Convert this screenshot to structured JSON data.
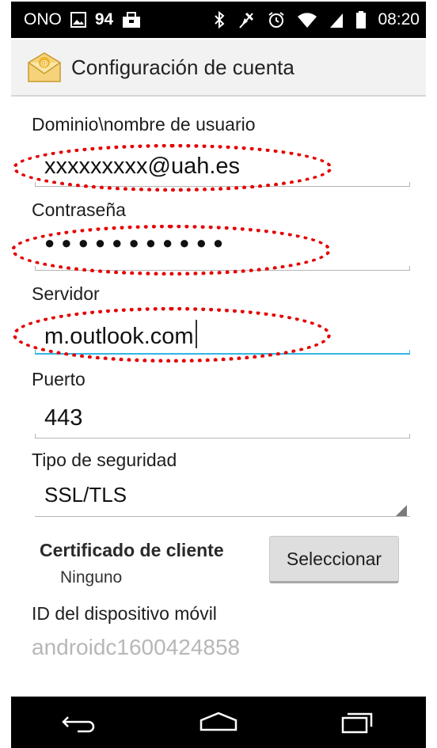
{
  "status_bar": {
    "carrier": "ONO",
    "notification_count": "94",
    "time": "08:20",
    "icons": [
      "gallery-icon",
      "briefcase-icon",
      "bluetooth-icon",
      "mute-icon",
      "alarm-icon",
      "wifi-icon",
      "signal-icon",
      "battery-icon"
    ]
  },
  "action_bar": {
    "icon": "email-app-icon",
    "title": "Configuración de cuenta"
  },
  "form": {
    "username": {
      "label": "Dominio\\nombre de usuario",
      "value": "xxxxxxxxx@uah.es"
    },
    "password": {
      "label": "Contraseña",
      "value": "●●●●●●●●●●●"
    },
    "server": {
      "label": "Servidor",
      "value": "m.outlook.com"
    },
    "port": {
      "label": "Puerto",
      "value": "443"
    },
    "security": {
      "label": "Tipo de seguridad",
      "value": "SSL/TLS"
    },
    "client_certificate": {
      "label": "Certificado de cliente",
      "value": "Ninguno",
      "button": "Seleccionar"
    },
    "device_id": {
      "label": "ID del dispositivo móvil",
      "value": "androidc1600424858"
    }
  },
  "colors": {
    "highlight_oval": "#e40000",
    "focus_underline": "#33b5e5",
    "device_id_text": "#b7b7b7"
  },
  "nav_bar": {
    "icons": [
      "back-icon",
      "home-icon",
      "recents-icon"
    ]
  }
}
